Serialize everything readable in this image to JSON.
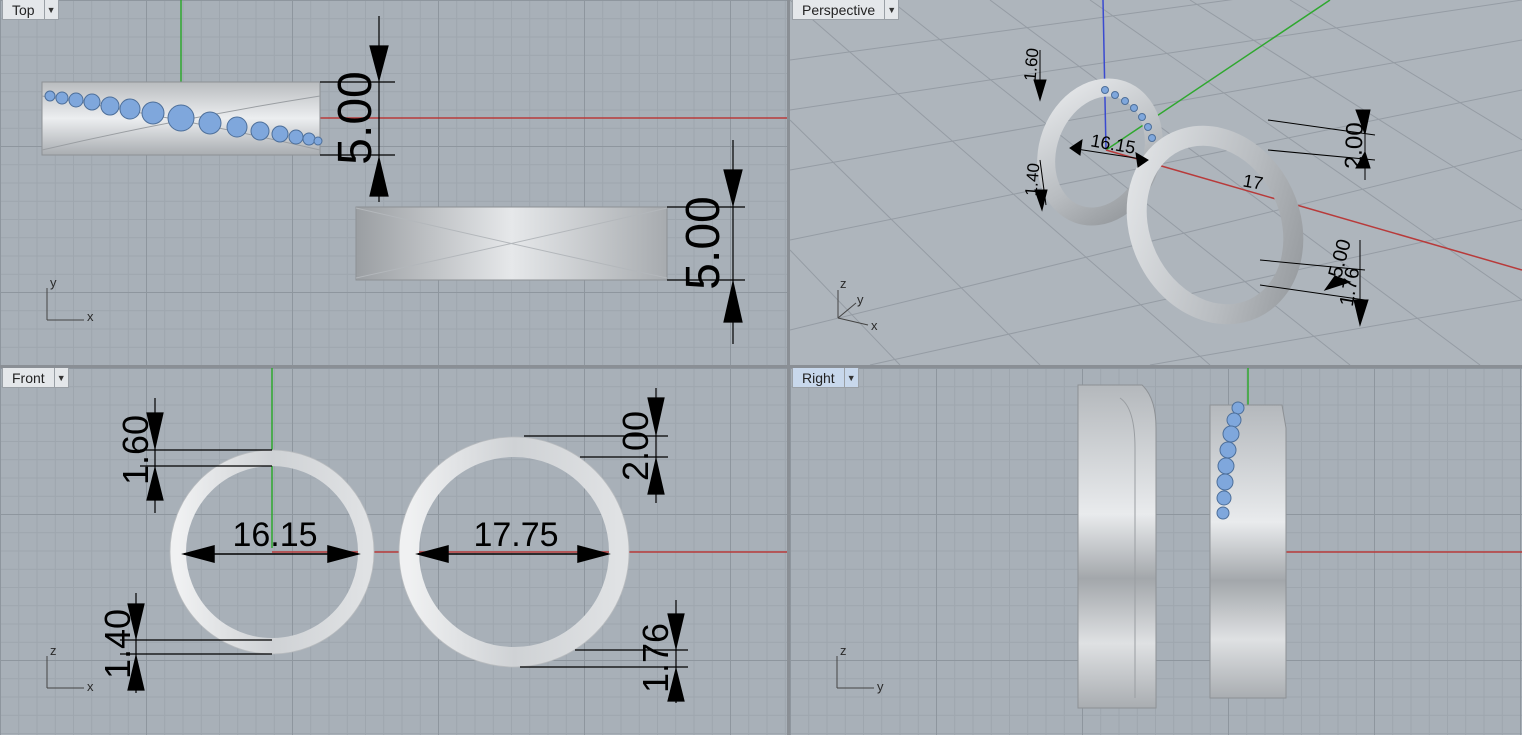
{
  "viewports": {
    "top": {
      "label": "Top",
      "dims": [
        "5.00",
        "5.00"
      ],
      "axes": {
        "v": "y",
        "h": "x"
      }
    },
    "perspective": {
      "label": "Perspective",
      "dims": [
        "1.60",
        "16.15",
        "1.40",
        "2.00",
        "5.00",
        "1.76",
        "17"
      ],
      "axes": {
        "a": "z",
        "b": "y",
        "c": "x"
      }
    },
    "front": {
      "label": "Front",
      "dims": [
        "1.60",
        "16.15",
        "17.75",
        "2.00",
        "1.40",
        "1.76"
      ],
      "axes": {
        "v": "z",
        "h": "x"
      }
    },
    "right": {
      "label": "Right",
      "axes": {
        "v": "z",
        "h": "y"
      }
    }
  },
  "colors": {
    "x_axis": "#b83a3a",
    "y_axis": "#2fa82f",
    "z_axis": "#3a4ad0",
    "gem": "#7fa7dc",
    "metal": "#cfd2d5"
  },
  "icons": [
    "dropdown-arrow-icon"
  ]
}
